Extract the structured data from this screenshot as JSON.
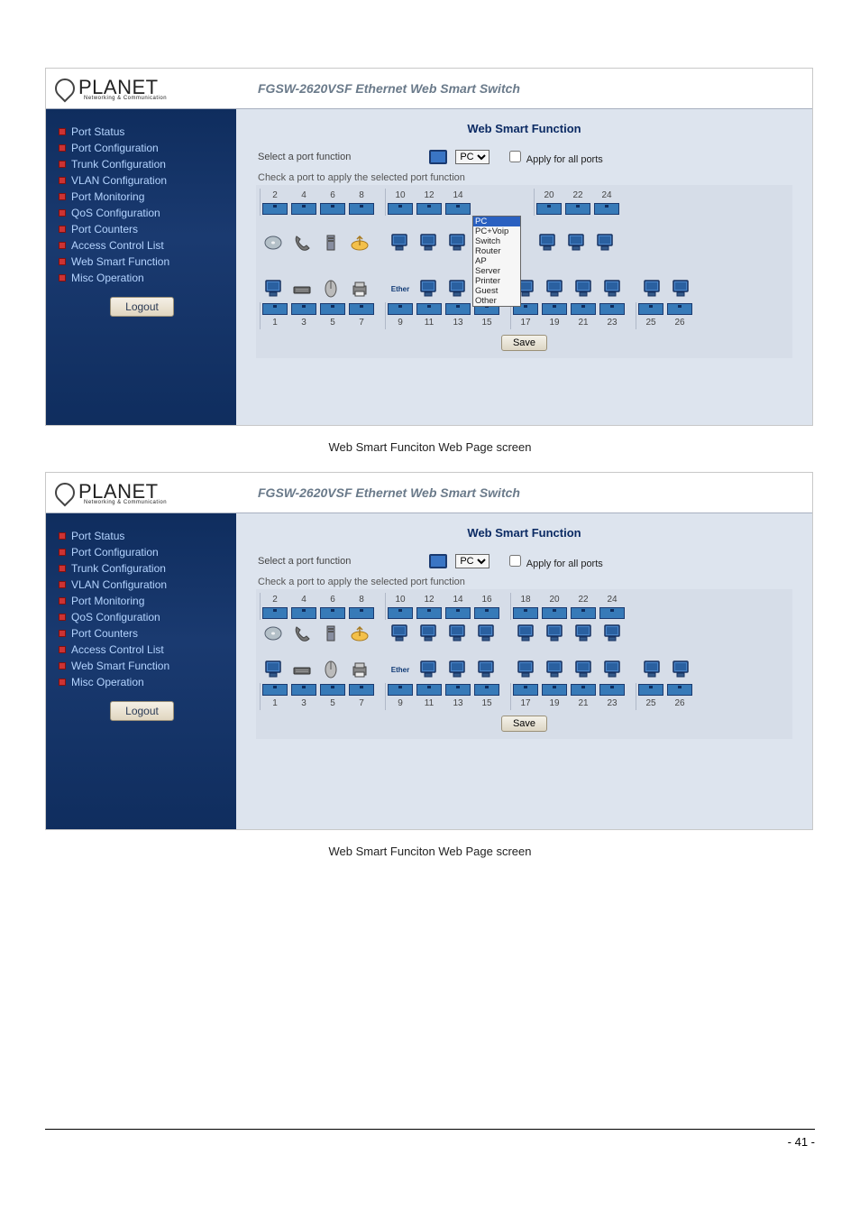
{
  "product_title": "FGSW-2620VSF Ethernet Web Smart Switch",
  "logo": "PLANET",
  "logo_sub": "Networking & Communication",
  "sidebar": {
    "items": [
      {
        "label": "Port Status"
      },
      {
        "label": "Port Configuration"
      },
      {
        "label": "Trunk Configuration"
      },
      {
        "label": "VLAN Configuration"
      },
      {
        "label": "Port Monitoring"
      },
      {
        "label": "QoS Configuration"
      },
      {
        "label": "Port Counters"
      },
      {
        "label": "Access Control List"
      },
      {
        "label": "Web Smart Function"
      },
      {
        "label": "Misc Operation"
      }
    ],
    "logout": "Logout"
  },
  "panel": {
    "title": "Web Smart Function",
    "select_label": "Select a port function",
    "dropdown_selected": "PC",
    "dropdown_options": [
      "PC",
      "PC+Voip",
      "Switch",
      "Router",
      "AP",
      "Server",
      "Printer",
      "Guest",
      "Other"
    ],
    "apply_label": "Apply for all ports",
    "check_label": "Check a port to apply the selected port function",
    "save": "Save",
    "top_ports": [
      "2",
      "4",
      "6",
      "8",
      "10",
      "12",
      "14",
      "16",
      "18",
      "20",
      "22",
      "24"
    ],
    "bot_ports": [
      "1",
      "3",
      "5",
      "7",
      "9",
      "11",
      "13",
      "15",
      "17",
      "19",
      "21",
      "23"
    ],
    "fiber_top": [
      "",
      ""
    ],
    "fiber_bot": [
      "25",
      "26"
    ],
    "ether_label": "Ether"
  },
  "caption1": "Web Smart Funciton Web Page screen",
  "caption2": "Web Smart Funciton Web Page screen",
  "page_num": "- 41 -"
}
